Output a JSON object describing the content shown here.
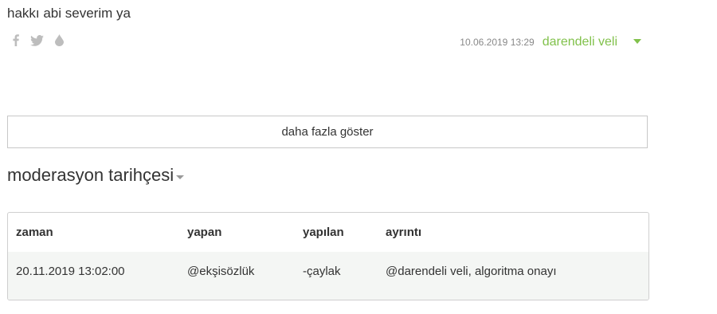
{
  "entry": {
    "text": "hakkı abi severim ya",
    "date": "10.06.2019 13:29",
    "author": "darendeli veli"
  },
  "share_icons": [
    "facebook-icon",
    "twitter-icon",
    "drop-icon"
  ],
  "colors": {
    "author": "#81c14b",
    "icon": "#bdbdbd",
    "row_bg": "#f4f6f4"
  },
  "more_button": {
    "label": "daha fazla göster"
  },
  "moderation": {
    "title": "moderasyon tarihçesi",
    "columns": [
      "zaman",
      "yapan",
      "yapılan",
      "ayrıntı"
    ],
    "rows": [
      [
        "20.11.2019 13:02:00",
        "@ekşisözlük",
        "-çaylak",
        "@darendeli veli, algoritma onayı"
      ]
    ]
  }
}
